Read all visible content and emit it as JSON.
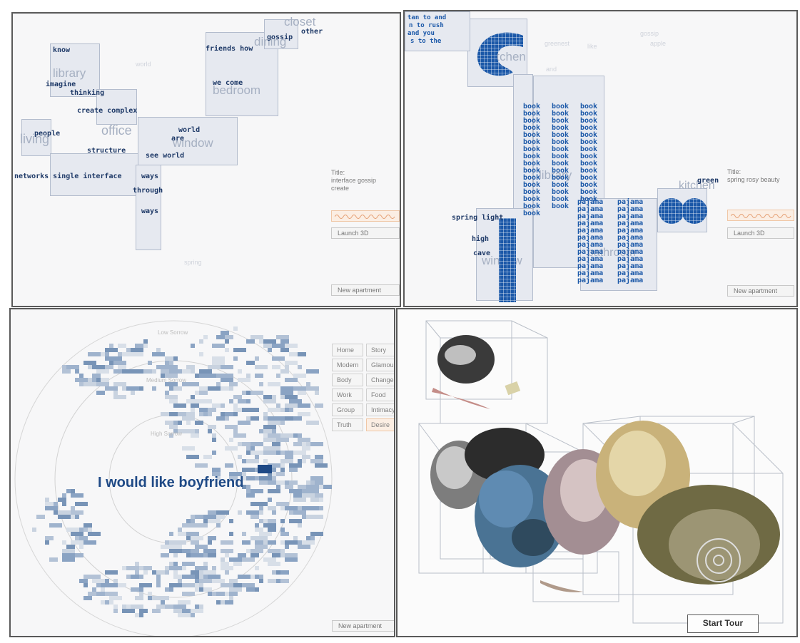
{
  "panel1": {
    "rooms": {
      "library": "library",
      "office": "office",
      "living": "living",
      "bedroom": "bedroom",
      "window": "window",
      "closet": "closet",
      "dining": "dining"
    },
    "words": {
      "know": "know",
      "imagine": "imagine",
      "thinking": "thinking",
      "create_complex": "create complex",
      "people": "people",
      "structure": "structure",
      "networks": "networks single interface",
      "world": "world",
      "are": "are",
      "see_world": "see world",
      "ways1": "ways",
      "through": "through",
      "ways2": "ways",
      "friends_how": "friends how",
      "we_come": "we come",
      "gossip": "gossip",
      "other": "other"
    },
    "faint": {
      "a": "world",
      "b": "spring"
    },
    "title_label": "Title:",
    "title_value1": "interface gossip",
    "title_value2": "create",
    "launch": "Launch 3D",
    "new_apartment": "New apartment"
  },
  "panel2": {
    "rooms": {
      "kitchen": "kitchen",
      "library": "library",
      "window": "window",
      "bathroom": "bathroom"
    },
    "words": {
      "spring_light": "spring light",
      "high": "high",
      "cave": "cave",
      "book": "book",
      "pajama": "pajama",
      "green": "green"
    },
    "faint": {
      "a": "greenest",
      "b": "like",
      "c": "gossip",
      "d": "apple",
      "e": "and"
    },
    "title_label": "Title:",
    "title_value1": "spring rosy beauty",
    "launch": "Launch 3D",
    "new_apartment": "New apartment"
  },
  "panel3": {
    "ring_labels": {
      "low": "Low Sorrow",
      "medium": "Medium Sorrow",
      "high": "High Sorrow"
    },
    "message": "I would like boyfriend",
    "categories": [
      [
        "Home",
        "Story"
      ],
      [
        "Modern",
        "Glamour"
      ],
      [
        "Body",
        "Change"
      ],
      [
        "Work",
        "Food"
      ],
      [
        "Group",
        "Intimacy"
      ],
      [
        "Truth",
        "Desire"
      ]
    ],
    "new_apartment": "New apartment"
  },
  "panel4": {
    "start_tour": "Start Tour"
  }
}
